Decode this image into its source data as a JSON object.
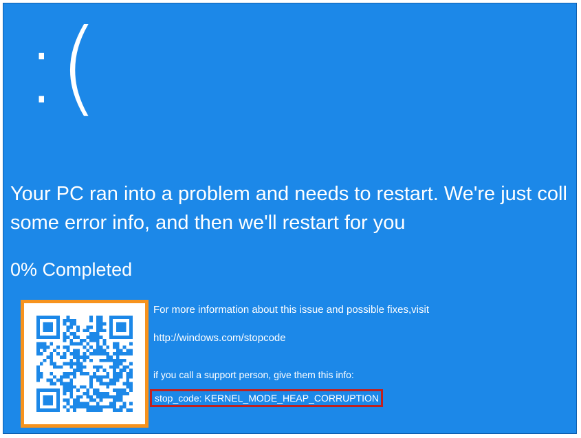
{
  "screen": {
    "sad_face": ":(",
    "message_line1": "Your PC ran into a problem and needs to restart. We're just coll",
    "message_line2": "some error info, and then we'll restart for you",
    "progress_text": "0% Completed",
    "more_info_text": "For more information about this issue and possible fixes,visit",
    "url_text": "http://windows.com/stopcode",
    "support_text": "if you call a support person, give them this info:",
    "stop_code_text": "stop_code: KERNEL_MODE_HEAP_CORRUPTION"
  },
  "colors": {
    "background": "#1c88e8",
    "text": "#ffffff",
    "qr_highlight": "#f7931e",
    "stop_code_highlight": "#c0211f"
  },
  "icons": {
    "qr_code": "qr-code-icon"
  }
}
